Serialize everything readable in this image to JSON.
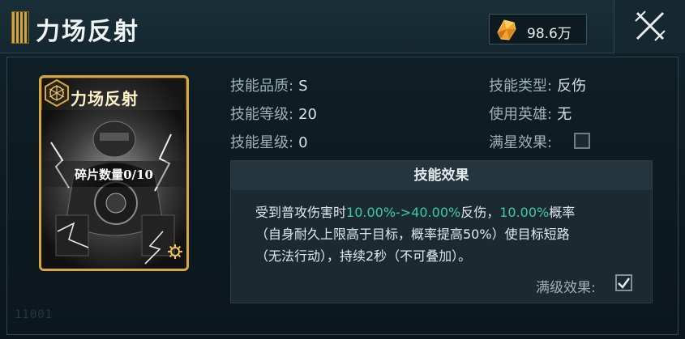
{
  "header": {
    "title": "力场反射",
    "currency_value": "98.6万"
  },
  "card": {
    "title": "力场反射",
    "fragments": "碎片数量0/10"
  },
  "stats": {
    "quality_label": "技能品质:",
    "quality_value": "S",
    "level_label": "技能等级:",
    "level_value": "20",
    "star_label": "技能星级:",
    "star_value": "0",
    "type_label": "技能类型:",
    "type_value": "反伤",
    "hero_label": "使用英雄:",
    "hero_value": "无",
    "fullstar_label": "满星效果:",
    "fullstar_checked": false
  },
  "effect": {
    "heading": "技能效果",
    "line1_a": "受到普攻伤害时",
    "line1_b": "10.00%->40.00%",
    "line1_c": "反伤，",
    "line1_d": "10.00%",
    "line1_e": "概率",
    "line2": "（自身耐久上限高于目标，概率提高50%）使目标短路",
    "line3": "（无法行动），持续2秒（不可叠加）。",
    "full_level_label": "满级效果:",
    "full_level_checked": true
  },
  "footer": {
    "id_text": "11001"
  },
  "colors": {
    "highlight": "#3fc9a4",
    "card_gold": "#d9a642"
  }
}
